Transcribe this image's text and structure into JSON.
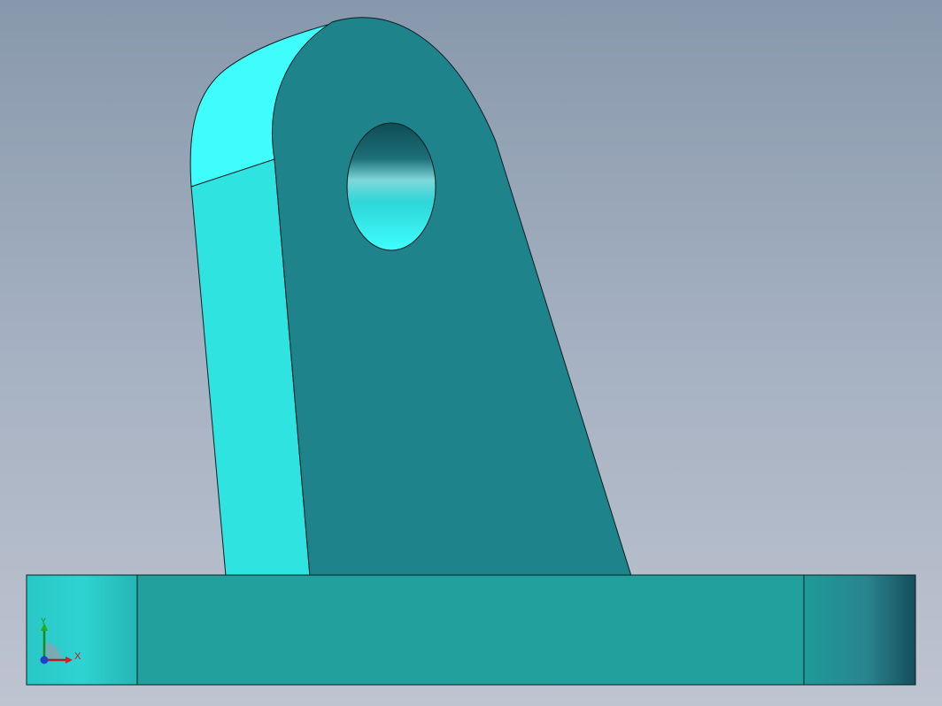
{
  "viewport": {
    "background_top": "#8898ac",
    "background_bottom": "#bec4d0"
  },
  "model": {
    "face_front_color": "#1e838b",
    "face_side_color": "#2ee4e2",
    "face_top_color": "#3dfcfb",
    "base_color": "#21a09e",
    "edge_color": "#0a1f22"
  },
  "triad": {
    "x_label": "X",
    "y_label": "Y",
    "x_color": "#c41818",
    "y_color": "#1a8a1a",
    "z_color": "#1f3fcf"
  }
}
